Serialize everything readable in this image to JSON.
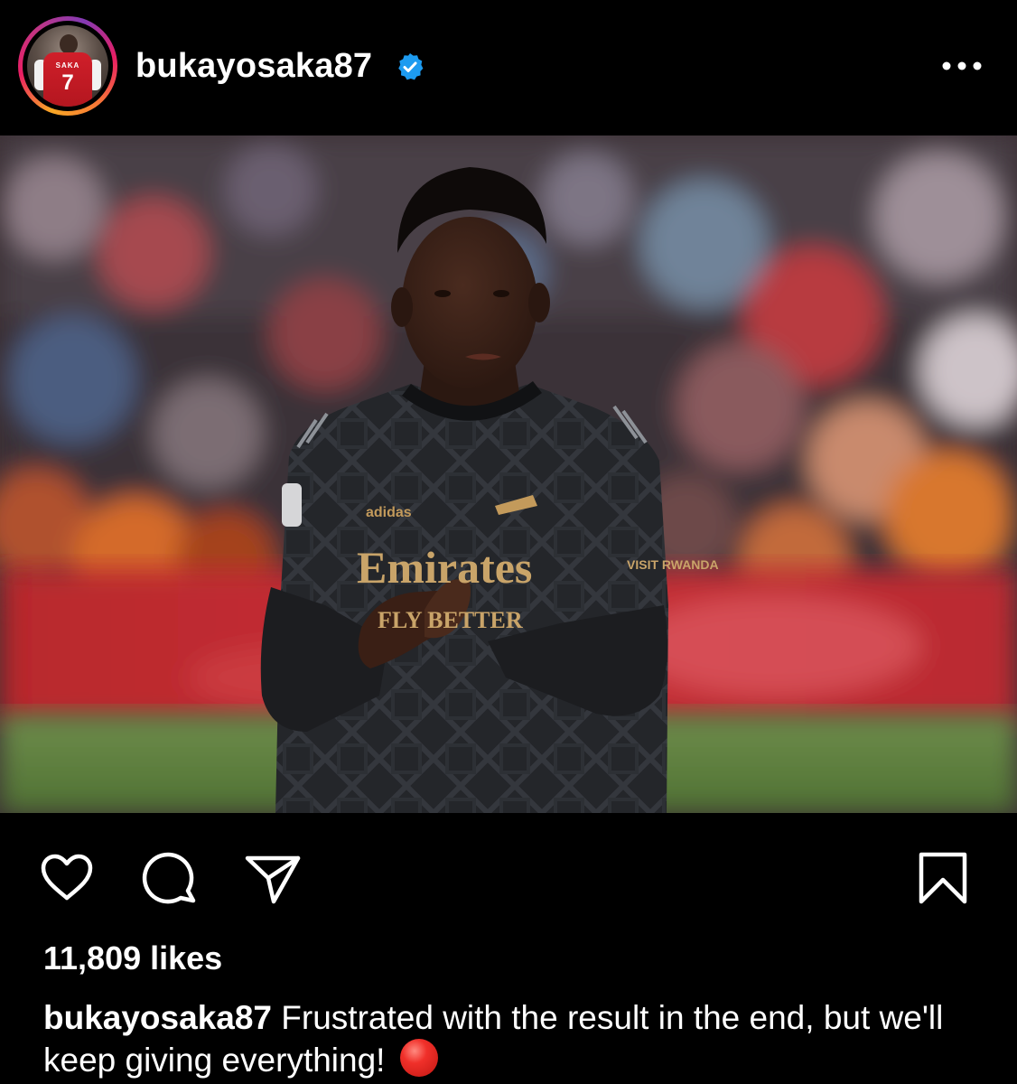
{
  "post": {
    "username": "bukayosaka87",
    "verified": true,
    "avatar": {
      "shirt_name": "SAKA",
      "shirt_number": "7"
    },
    "photo": {
      "shirt_brand": "adidas",
      "shirt_sponsor_line1": "Emirates",
      "shirt_sponsor_line2": "FLY BETTER",
      "sleeve_sponsor": "VISIT RWANDA"
    },
    "likes_text": "11,809 likes",
    "caption": {
      "username": "bukayosaka87",
      "text": "Frustrated with the result in the end, but we'll keep giving everything!",
      "emoji": "red-circle-emoji"
    }
  },
  "icons": {
    "verified": "verified-badge-icon",
    "more": "more-options-icon",
    "like": "heart-icon",
    "comment": "comment-icon",
    "share": "send-icon",
    "save": "bookmark-icon"
  },
  "colors": {
    "background": "#000000",
    "text": "#ffffff",
    "verified_badge": "#1d9bf0",
    "emoji_red": "#e5281f"
  }
}
